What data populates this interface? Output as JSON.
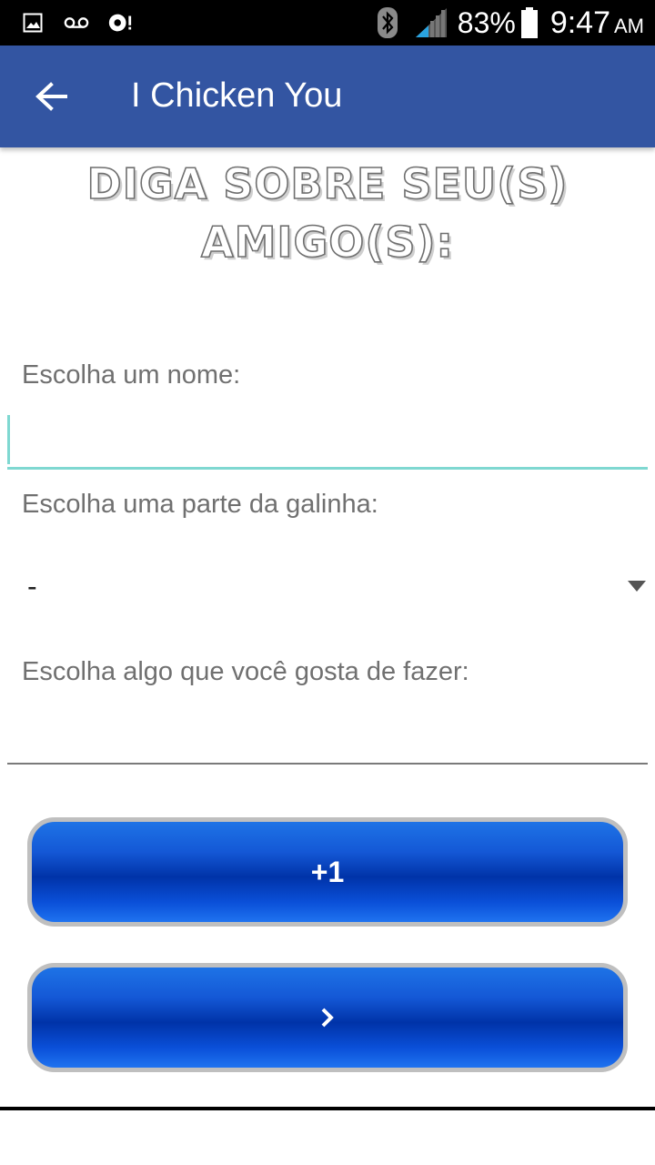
{
  "status_bar": {
    "battery": "83%",
    "time": "9:47",
    "ampm": "AM",
    "icons": [
      "gallery-icon",
      "voicemail-icon",
      "sync-alert-icon",
      "bluetooth-icon",
      "signal-icon",
      "battery-icon"
    ]
  },
  "app_bar": {
    "title": "I Chicken You",
    "back_icon": "arrow-back-icon"
  },
  "form": {
    "heading": "Diga sobre seu(s) amigo(s):",
    "name_label": "Escolha um nome:",
    "name_value": "",
    "part_label": "Escolha uma parte da galinha:",
    "part_selected": "-",
    "hobby_label": "Escolha algo que você gosta de fazer:",
    "hobby_value": ""
  },
  "buttons": {
    "add_label": "+1",
    "next_label": "›"
  },
  "colors": {
    "app_bar": "#3355A2",
    "accent": "#7FD8D1",
    "button_blue": "#0033A8"
  }
}
